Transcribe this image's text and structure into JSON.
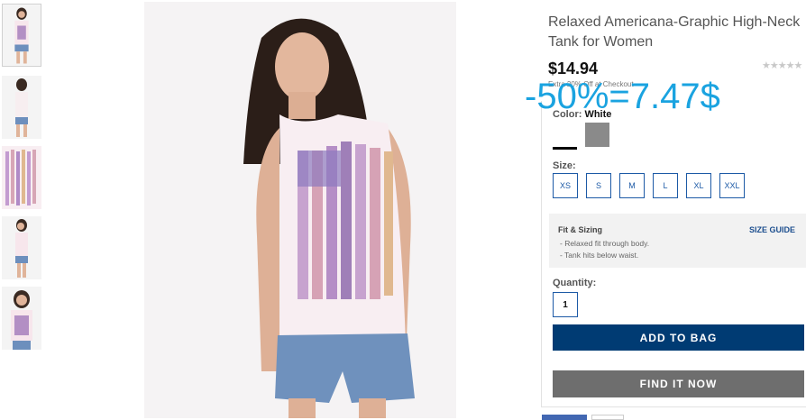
{
  "product": {
    "title_line1": "Relaxed Americana-Graphic High-Neck",
    "title_line2": "Tank for Women",
    "price": "$14.94",
    "rating_stars": "★★★★★",
    "promo_text": "Extra 20% Off at Checkout"
  },
  "overlay": {
    "discount_text": "-50%=7.47$"
  },
  "color": {
    "label": "Color:",
    "selected": "White",
    "swatches": [
      "white",
      "gray"
    ]
  },
  "size": {
    "label": "Size:",
    "options": [
      "XS",
      "S",
      "M",
      "L",
      "XL",
      "XXL"
    ]
  },
  "fit": {
    "title": "Fit & Sizing",
    "size_guide": "SIZE GUIDE",
    "notes": [
      "- Relaxed fit through body.",
      "- Tank hits below waist."
    ]
  },
  "quantity": {
    "label": "Quantity:",
    "value": "1"
  },
  "actions": {
    "add_to_bag": "ADD TO BAG",
    "find_it_now": "FIND IT NOW"
  },
  "colors": {
    "primary_button": "#003b73",
    "secondary_button": "#6e6e6e",
    "size_border": "#1d5aa6",
    "overlay_text": "#1aa3e0"
  }
}
